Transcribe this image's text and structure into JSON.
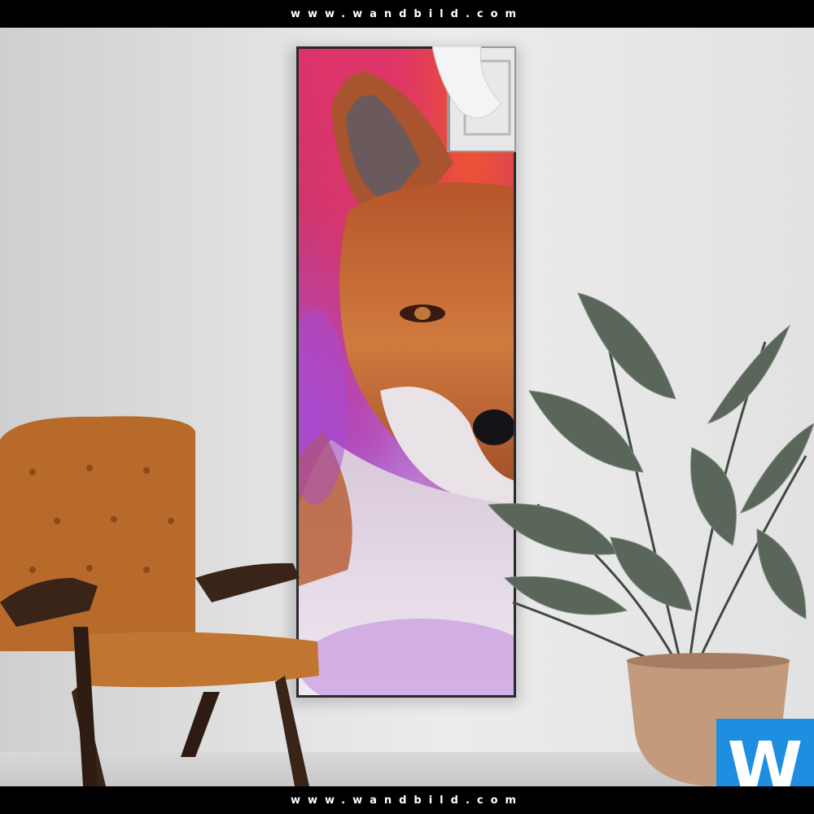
{
  "header": {
    "url_text": "www.wandbild.com"
  },
  "footer": {
    "url_text": "www.wandbild.com"
  },
  "logo": {
    "letter": "W",
    "color": "#1e8ee0"
  },
  "colors": {
    "wall": "#e6e6e6",
    "poster_magenta": "#d9316a",
    "poster_purple": "#a24aa4",
    "fox_orange": "#c8642a",
    "chair_leather": "#b86a2a",
    "chair_wood": "#3a2418",
    "plant_leaf": "#5a665a",
    "pot": "#c49a7c"
  }
}
